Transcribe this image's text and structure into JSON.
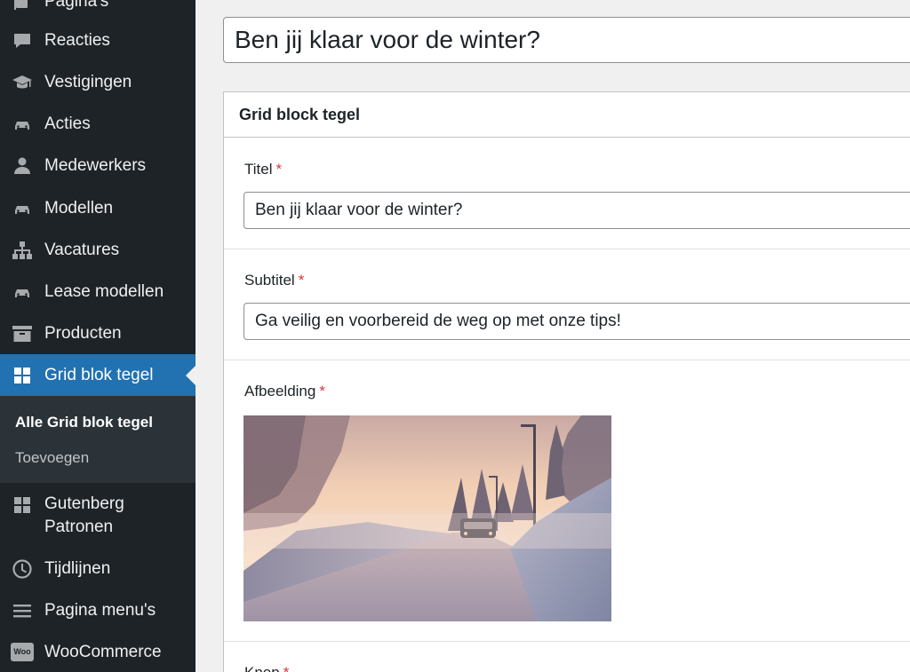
{
  "sidebar": {
    "items": [
      {
        "label": "Pagina's",
        "icon": "pages-icon"
      },
      {
        "label": "Reacties",
        "icon": "comments-icon"
      },
      {
        "label": "Vestigingen",
        "icon": "graduation-cap-icon"
      },
      {
        "label": "Acties",
        "icon": "car-icon"
      },
      {
        "label": "Medewerkers",
        "icon": "user-icon"
      },
      {
        "label": "Modellen",
        "icon": "car-icon"
      },
      {
        "label": "Vacatures",
        "icon": "network-icon"
      },
      {
        "label": "Lease modellen",
        "icon": "car-icon"
      },
      {
        "label": "Producten",
        "icon": "archive-icon"
      },
      {
        "label": "Grid blok tegel",
        "icon": "grid-icon"
      },
      {
        "label": "Gutenberg",
        "label2": "Patronen",
        "icon": "grid-icon"
      },
      {
        "label": "Tijdlijnen",
        "icon": "clock-icon"
      },
      {
        "label": "Pagina menu's",
        "icon": "menu-icon"
      },
      {
        "label": "WooCommerce",
        "icon": "woo-icon",
        "icon_text": "Woo"
      }
    ],
    "submenu": [
      {
        "label": "Alle Grid blok tegel"
      },
      {
        "label": "Toevoegen"
      }
    ]
  },
  "post": {
    "title": "Ben jij klaar voor de winter?"
  },
  "panel": {
    "header": "Grid block tegel",
    "required_mark": "*",
    "fields": {
      "titel": {
        "label": "Titel",
        "value": "Ben jij klaar voor de winter?"
      },
      "subtitel": {
        "label": "Subtitel",
        "value": "Ga veilig en voorbereid de weg op met onze tips!"
      },
      "afbeelding": {
        "label": "Afbeelding"
      },
      "knop": {
        "label": "Knop"
      }
    }
  },
  "colors": {
    "sidebar_bg": "#1d2327",
    "active_bg": "#2271b1",
    "required": "#d63638"
  }
}
